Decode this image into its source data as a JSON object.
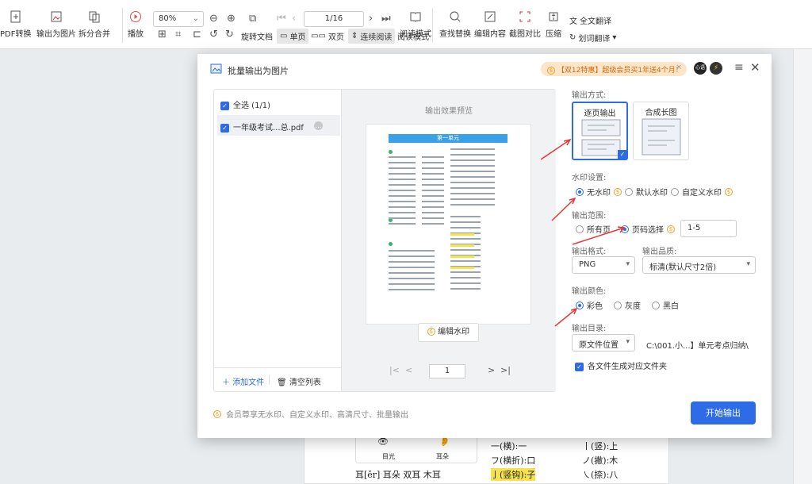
{
  "toolbar": {
    "pdf_convert": "PDF转换",
    "export_image": "输出为图片",
    "split_merge": "拆分合并",
    "play": "播放",
    "zoom": "80%",
    "page_indicator": "1/16",
    "rotate_doc": "旋转文档",
    "single_page": "单页",
    "double_page": "双页",
    "continuous": "连续阅读",
    "read_mode": "阅读模式",
    "find_replace": "查找替换",
    "edit_content": "编辑内容",
    "screenshot_compare": "截图对比",
    "compress": "压缩",
    "full_translate": "全文翻译",
    "word_translate": "划词翻译"
  },
  "dialog": {
    "title": "批量输出为图片",
    "promo": "【双12特惠】超级会员买1年送4个月！",
    "avatar": "心语",
    "file_list": {
      "select_all": "全选 (1/1)",
      "file_name": "一年级考试...总.pdf",
      "add_file": "添加文件",
      "clear_list": "清空列表"
    },
    "preview": {
      "label": "输出效果预览",
      "page_header": "第一单元",
      "edit_watermark": "编辑水印",
      "page_input": "1"
    },
    "options": {
      "mode_label": "输出方式:",
      "mode_per_page": "逐页输出",
      "mode_long": "合成长图",
      "watermark_label": "水印设置:",
      "wm_none": "无水印",
      "wm_default": "默认水印",
      "wm_custom": "自定义水印",
      "range_label": "输出范围:",
      "range_all": "所有页",
      "range_select": "页码选择",
      "range_value": "1-5",
      "format_label": "输出格式:",
      "format_value": "PNG",
      "quality_label": "输出品质:",
      "quality_value": "标清(默认尺寸2倍)",
      "color_label": "输出颜色:",
      "color_full": "彩色",
      "color_gray": "灰度",
      "color_bw": "黑白",
      "dir_label": "输出目录:",
      "dir_select": "原文件位置",
      "dir_path": "C:\\001.小...】单元考点归纳\\",
      "folder_option": "各文件生成对应文件夹"
    },
    "footnote": "会员尊享无水印、自定义水印、高清尺寸、批量输出",
    "start_button": "开始输出"
  },
  "background_doc": {
    "line1_left": "一(横):一",
    "line1_right": "丨(竖):上",
    "line2_left": "フ(横折):口",
    "line2_right": "ノ(撇):木",
    "line3_left": "亅(竖钩):子",
    "line3_right": "㇏(捺):八",
    "eye_label": "目光",
    "ear_label": "耳朵",
    "bottom_row": "耳[ěr] 耳朵   双耳   木耳"
  }
}
